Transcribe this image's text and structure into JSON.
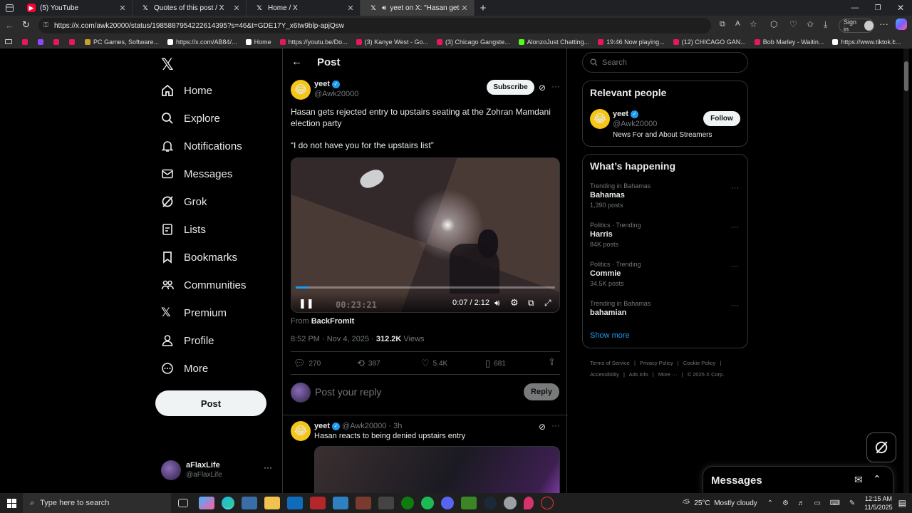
{
  "browser": {
    "tabs": [
      {
        "title": "(5) YouTube",
        "icon": "youtube-icon",
        "color": "#ff0033"
      },
      {
        "title": "Quotes of this post / X",
        "icon": "x-icon",
        "color": "#ffffff"
      },
      {
        "title": "Home / X",
        "icon": "x-icon",
        "color": "#ffffff"
      },
      {
        "title": "yeet on X: \"Hasan gets rejec",
        "icon": "x-icon",
        "color": "#ffffff"
      }
    ],
    "url": "https://x.com/awk20000/status/1985887954222614395?s=46&t=GDE17Y_x6tw9blp-apjQsw",
    "signin": "Sign in",
    "bookmarks": [
      {
        "label": "",
        "color": "#e8175d"
      },
      {
        "label": "",
        "color": "#9146ff"
      },
      {
        "label": "",
        "color": "#e8175d"
      },
      {
        "label": "",
        "color": "#e8175d"
      },
      {
        "label": "PC Games, Software...",
        "color": "#c9a227"
      },
      {
        "label": "https://x.com/AB84/...",
        "color": "#ffffff"
      },
      {
        "label": "Home",
        "color": "#ffffff"
      },
      {
        "label": "https://youtu.be/Do...",
        "color": "#e8175d"
      },
      {
        "label": "(3) Kanye West - Go...",
        "color": "#e8175d"
      },
      {
        "label": "(3) Chicago Gangste...",
        "color": "#e8175d"
      },
      {
        "label": "AlonzoJust Chatting...",
        "color": "#53fc18"
      },
      {
        "label": "19:46 Now playing...",
        "color": "#e8175d"
      },
      {
        "label": "(12) CHICAGO GAN...",
        "color": "#e8175d"
      },
      {
        "label": "Bob Marley - Waitin...",
        "color": "#e8175d"
      },
      {
        "label": "https://www.tiktok.c...",
        "color": "#ffffff"
      }
    ]
  },
  "sidebar": {
    "items": [
      {
        "label": "Home",
        "icon": "home-icon"
      },
      {
        "label": "Explore",
        "icon": "search-icon"
      },
      {
        "label": "Notifications",
        "icon": "bell-icon"
      },
      {
        "label": "Messages",
        "icon": "envelope-icon"
      },
      {
        "label": "Grok",
        "icon": "grok-icon"
      },
      {
        "label": "Lists",
        "icon": "lists-icon"
      },
      {
        "label": "Bookmarks",
        "icon": "bookmark-icon"
      },
      {
        "label": "Communities",
        "icon": "communities-icon"
      },
      {
        "label": "Premium",
        "icon": "x-icon"
      },
      {
        "label": "Profile",
        "icon": "person-icon"
      },
      {
        "label": "More",
        "icon": "more-circle-icon"
      }
    ],
    "post_label": "Post",
    "account": {
      "name": "aFlaxLife",
      "handle": "@aFlaxLife"
    }
  },
  "main": {
    "header": "Post",
    "tweet": {
      "name": "yeet",
      "handle": "@Awk20000",
      "subscribe": "Subscribe",
      "text1": "Hasan gets rejected entry to upstairs seating at the Zohran Mamdani election party",
      "text2": "“I do not have you for the upstairs list”",
      "video": {
        "time": "0:07 / 2:12",
        "overlay_timestamp": "00:23:21",
        "progress": 0.05
      },
      "from_label": "From",
      "from": "BackFromIt",
      "meta_time": "8:52 PM · Nov 4, 2025 ·",
      "views_count": "312.2K",
      "views_label": "Views",
      "stats": {
        "replies": "270",
        "reposts": "387",
        "likes": "5.4K",
        "bookmarks": "681"
      }
    },
    "reply": {
      "placeholder": "Post your reply",
      "button": "Reply"
    },
    "next_tweet": {
      "name": "yeet",
      "handle": "@Awk20000 · 3h",
      "text": "Hasan reacts to being denied upstairs entry"
    }
  },
  "right": {
    "search_placeholder": "Search",
    "relevant": {
      "title": "Relevant people",
      "name": "yeet",
      "handle": "@Awk20000",
      "bio": "News For and About Streamers",
      "follow": "Follow"
    },
    "happening": {
      "title": "What’s happening",
      "trends": [
        {
          "context": "Trending in Bahamas",
          "topic": "Bahamas",
          "count": "1,390 posts"
        },
        {
          "context": "Politics · Trending",
          "topic": "Harris",
          "count": "84K posts"
        },
        {
          "context": "Politics · Trending",
          "topic": "Commie",
          "count": "34.5K posts"
        },
        {
          "context": "Trending in Bahamas",
          "topic": "bahamian",
          "count": ""
        }
      ],
      "show_more": "Show more"
    },
    "footer": {
      "line1": [
        "Terms of Service",
        "Privacy Policy",
        "Cookie Policy"
      ],
      "line2": [
        "Accessibility",
        "Ads info",
        "More ···",
        "© 2025 X Corp."
      ]
    },
    "messages": "Messages"
  },
  "taskbar": {
    "search": "Type here to search",
    "weather": "25°C  Mostly cloudy",
    "time": "12:15 AM",
    "date": "11/5/2025"
  }
}
